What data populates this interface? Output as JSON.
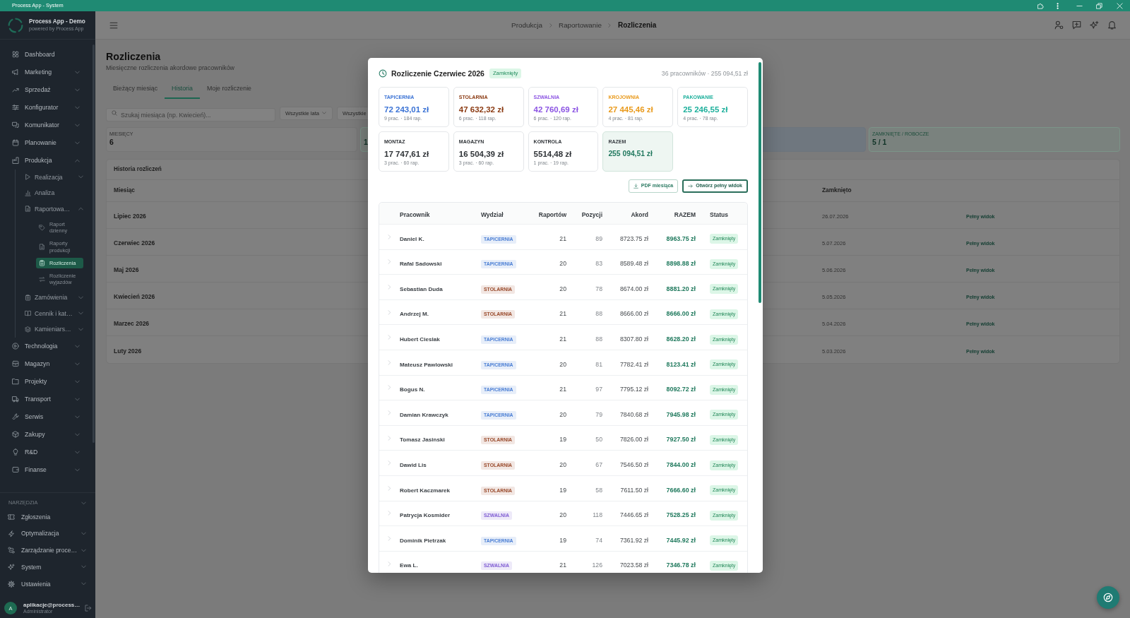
{
  "window": {
    "title": "Process App - System"
  },
  "sidebar": {
    "app_name": "Process App - Demo",
    "tagline": "powered by Process App",
    "items": [
      {
        "label": "Dashboard",
        "kind": "link",
        "selected": false
      },
      {
        "label": "Marketing",
        "kind": "group",
        "expanded": false,
        "selected": false
      },
      {
        "label": "Sprzedaż",
        "kind": "group",
        "expanded": false,
        "selected": false
      },
      {
        "label": "Konfigurator",
        "kind": "group",
        "expanded": false,
        "selected": false
      },
      {
        "label": "Komunikator",
        "kind": "group",
        "expanded": false,
        "selected": false
      },
      {
        "label": "Planowanie",
        "kind": "group",
        "expanded": false,
        "selected": false
      },
      {
        "label": "Produkcja",
        "kind": "group",
        "expanded": true,
        "selected": false,
        "children": [
          {
            "label": "Realizacja",
            "kind": "group",
            "expanded": false,
            "selected": false
          },
          {
            "label": "Analiza",
            "kind": "link",
            "selected": false
          },
          {
            "label": "Raportowa…",
            "kind": "group",
            "expanded": true,
            "selected": false,
            "children": [
              {
                "label": "Raport dzienny",
                "selected": false
              },
              {
                "label": "Raporty produkcji",
                "selected": false
              },
              {
                "label": "Rozliczenia",
                "selected": true
              },
              {
                "label": "Rozliczenie wyjazdów",
                "selected": false
              }
            ]
          },
          {
            "label": "Zamówienia",
            "kind": "group",
            "expanded": false,
            "selected": false
          },
          {
            "label": "Cennik i kat…",
            "kind": "group",
            "expanded": false,
            "selected": false
          },
          {
            "label": "Kamieniars…",
            "kind": "group",
            "expanded": false,
            "selected": false
          }
        ]
      },
      {
        "label": "Technologia",
        "kind": "group",
        "expanded": false,
        "selected": false
      },
      {
        "label": "Magazyn",
        "kind": "group",
        "expanded": false,
        "selected": false
      },
      {
        "label": "Projekty",
        "kind": "group",
        "expanded": false,
        "selected": false
      },
      {
        "label": "Transport",
        "kind": "group",
        "expanded": false,
        "selected": false
      },
      {
        "label": "Serwis",
        "kind": "group",
        "expanded": false,
        "selected": false
      },
      {
        "label": "Zakupy",
        "kind": "group",
        "expanded": false,
        "selected": false
      },
      {
        "label": "R&D",
        "kind": "group",
        "expanded": false,
        "selected": false
      },
      {
        "label": "Finanse",
        "kind": "group",
        "expanded": false,
        "selected": false
      }
    ],
    "tools": {
      "label": "NARZĘDZIA",
      "expanded": true,
      "items": [
        {
          "label": "Zgłoszenia",
          "kind": "link",
          "selected": false
        },
        {
          "label": "Optymalizacja",
          "kind": "group",
          "expanded": false,
          "selected": false
        },
        {
          "label": "Zarządzanie proce…",
          "kind": "group",
          "expanded": false,
          "selected": false
        },
        {
          "label": "System",
          "kind": "group",
          "expanded": false,
          "selected": false
        },
        {
          "label": "Ustawienia",
          "kind": "group",
          "expanded": false,
          "selected": false
        }
      ]
    },
    "user": {
      "initial": "A",
      "email": "aplikacje@process…",
      "role": "Administrator"
    }
  },
  "breadcrumb": [
    {
      "label": "Produkcja",
      "current": false
    },
    {
      "label": "Raportowanie",
      "current": false
    },
    {
      "label": "Rozliczenia",
      "current": true
    }
  ],
  "page": {
    "title": "Rozliczenia",
    "subtitle": "Miesięczne rozliczenia akordowe pracowników",
    "tabs": [
      {
        "label": "Bieżący miesiąc",
        "selected": false
      },
      {
        "label": "Historia",
        "selected": true
      },
      {
        "label": "Moje rozliczenie",
        "selected": false
      }
    ],
    "search": {
      "placeholder": "Szukaj miesiąca (np. Kwiecień)..."
    },
    "filters": [
      {
        "label": "Wszystkie lata",
        "caret": true
      },
      {
        "label": "Wszystkie",
        "caret": false
      }
    ],
    "stats": [
      {
        "label": "MIESIĘCY",
        "value": "6",
        "kind": "neutral"
      },
      {
        "value": "1",
        "kind": "success"
      },
      {
        "kind": "info"
      },
      {
        "label": "ZAMKNIĘTE / ROBOCZE",
        "value": "5 / 1",
        "kind": "success"
      }
    ],
    "history": {
      "title": "Historia rozliczeń",
      "columns": [
        "Miesiąc",
        "Zamknięto"
      ],
      "rows": [
        {
          "month": "Lipiec 2026",
          "closed": "26.07.2026",
          "action": "Pełny widok"
        },
        {
          "month": "Czerwiec 2026",
          "closed": "5.07.2026",
          "action": "Pełny widok"
        },
        {
          "month": "Maj 2026",
          "closed": "5.06.2026",
          "action": "Pełny widok"
        },
        {
          "month": "Kwiecień 2026",
          "closed": "5.05.2026",
          "action": "Pełny widok"
        },
        {
          "month": "Marzec 2026",
          "closed": "5.04.2026",
          "action": "Pełny widok"
        },
        {
          "month": "Luty 2026",
          "closed": "5.03.2026",
          "action": "Pełny widok"
        }
      ]
    }
  },
  "modal": {
    "title": "Rozliczenie Czerwiec 2026",
    "status": "Zamknięty",
    "summary": "36 pracowników · 255 094,51 zł",
    "departments": [
      {
        "name": "TAPICERNIA",
        "amount": "72 243,01 zł",
        "detail": "9 prac. · 184 rap.",
        "color": "#3b73d5",
        "kind": "department"
      },
      {
        "name": "STOLARNIA",
        "amount": "47 632,32 zł",
        "detail": "6 prac. · 118 rap.",
        "color": "#8b3b13",
        "kind": "department"
      },
      {
        "name": "SZWALNIA",
        "amount": "42 760,69 zł",
        "detail": "6 prac. · 120 rap.",
        "color": "#8c55e3",
        "kind": "department"
      },
      {
        "name": "KROJOWNIA",
        "amount": "27 445,46 zł",
        "detail": "4 prac. · 81 rap.",
        "color": "#e99a1c",
        "kind": "department"
      },
      {
        "name": "PAKOWANIE",
        "amount": "25 246,55 zł",
        "detail": "4 prac. · 78 rap.",
        "color": "#1eb09c",
        "kind": "department"
      },
      {
        "name": "MONTAZ",
        "amount": "17 747,61 zł",
        "detail": "3 prac. · 60 rap.",
        "color": "#2f3337",
        "kind": "department"
      },
      {
        "name": "MAGAZYN",
        "amount": "16 504,39 zł",
        "detail": "3 prac. · 60 rap.",
        "color": "#2f3337",
        "kind": "department"
      },
      {
        "name": "KONTROLA",
        "amount": "5514,48 zł",
        "detail": "1 prac. · 19 rap.",
        "color": "#2f3337",
        "kind": "department"
      },
      {
        "name": "RAZEM",
        "amount": "255 094,51 zł",
        "color": "#22795f",
        "kind": "total"
      }
    ],
    "actions": [
      {
        "label": "PDF miesiąca",
        "kind": "download"
      },
      {
        "label": "Otwórz pełny widok",
        "kind": "open"
      }
    ],
    "table": {
      "columns": [
        "Pracownik",
        "Wydział",
        "Raportów",
        "Pozycji",
        "Akord",
        "RAZEM",
        "Status"
      ],
      "rows": [
        {
          "name": "Daniel K.",
          "department": "TAPICERNIA",
          "color": "#4a7ed4",
          "reports": "21",
          "positions": "89",
          "piecework": "8723.75 zł",
          "total": "8963.75 zł",
          "status": "Zamknięty",
          "expanded": false
        },
        {
          "name": "Rafal Sadowski",
          "department": "TAPICERNIA",
          "color": "#4a7ed4",
          "reports": "20",
          "positions": "83",
          "piecework": "8589.48 zł",
          "total": "8898.88 zł",
          "status": "Zamknięty",
          "expanded": false
        },
        {
          "name": "Sebastian Duda",
          "department": "STOLARNIA",
          "color": "#99492a",
          "reports": "20",
          "positions": "78",
          "piecework": "8674.00 zł",
          "total": "8881.20 zł",
          "status": "Zamknięty",
          "expanded": false
        },
        {
          "name": "Andrzej M.",
          "department": "STOLARNIA",
          "color": "#99492a",
          "reports": "21",
          "positions": "88",
          "piecework": "8666.00 zł",
          "total": "8666.00 zł",
          "status": "Zamknięty",
          "expanded": false
        },
        {
          "name": "Hubert Cieslak",
          "department": "TAPICERNIA",
          "color": "#4a7ed4",
          "reports": "21",
          "positions": "88",
          "piecework": "8307.80 zł",
          "total": "8628.20 zł",
          "status": "Zamknięty",
          "expanded": false
        },
        {
          "name": "Mateusz Pawlowski",
          "department": "TAPICERNIA",
          "color": "#4a7ed4",
          "reports": "20",
          "positions": "81",
          "piecework": "7782.41 zł",
          "total": "8123.41 zł",
          "status": "Zamknięty",
          "expanded": false
        },
        {
          "name": "Bogus N.",
          "department": "TAPICERNIA",
          "color": "#4a7ed4",
          "reports": "21",
          "positions": "97",
          "piecework": "7795.12 zł",
          "total": "8092.72 zł",
          "status": "Zamknięty",
          "expanded": false
        },
        {
          "name": "Damian Krawczyk",
          "department": "TAPICERNIA",
          "color": "#4a7ed4",
          "reports": "20",
          "positions": "79",
          "piecework": "7840.68 zł",
          "total": "7945.98 zł",
          "status": "Zamknięty",
          "expanded": false
        },
        {
          "name": "Tomasz Jasinski",
          "department": "STOLARNIA",
          "color": "#99492a",
          "reports": "19",
          "positions": "50",
          "piecework": "7826.00 zł",
          "total": "7927.50 zł",
          "status": "Zamknięty",
          "expanded": false
        },
        {
          "name": "Dawid Lis",
          "department": "STOLARNIA",
          "color": "#99492a",
          "reports": "20",
          "positions": "67",
          "piecework": "7546.50 zł",
          "total": "7844.00 zł",
          "status": "Zamknięty",
          "expanded": false
        },
        {
          "name": "Robert Kaczmarek",
          "department": "STOLARNIA",
          "color": "#99492a",
          "reports": "19",
          "positions": "58",
          "piecework": "7611.50 zł",
          "total": "7666.60 zł",
          "status": "Zamknięty",
          "expanded": false
        },
        {
          "name": "Patrycja Kosmider",
          "department": "SZWALNIA",
          "color": "#7e5bd3",
          "reports": "20",
          "positions": "118",
          "piecework": "7446.65 zł",
          "total": "7528.25 zł",
          "status": "Zamknięty",
          "expanded": false
        },
        {
          "name": "Dominik Pietrzak",
          "department": "TAPICERNIA",
          "color": "#4a7ed4",
          "reports": "19",
          "positions": "74",
          "piecework": "7361.92 zł",
          "total": "7445.92 zł",
          "status": "Zamknięty",
          "expanded": false
        },
        {
          "name": "Ewa L.",
          "department": "SZWALNIA",
          "color": "#7e5bd3",
          "reports": "21",
          "positions": "126",
          "piecework": "7023.58 zł",
          "total": "7346.78 zł",
          "status": "Zamknięty",
          "expanded": false
        }
      ]
    }
  }
}
